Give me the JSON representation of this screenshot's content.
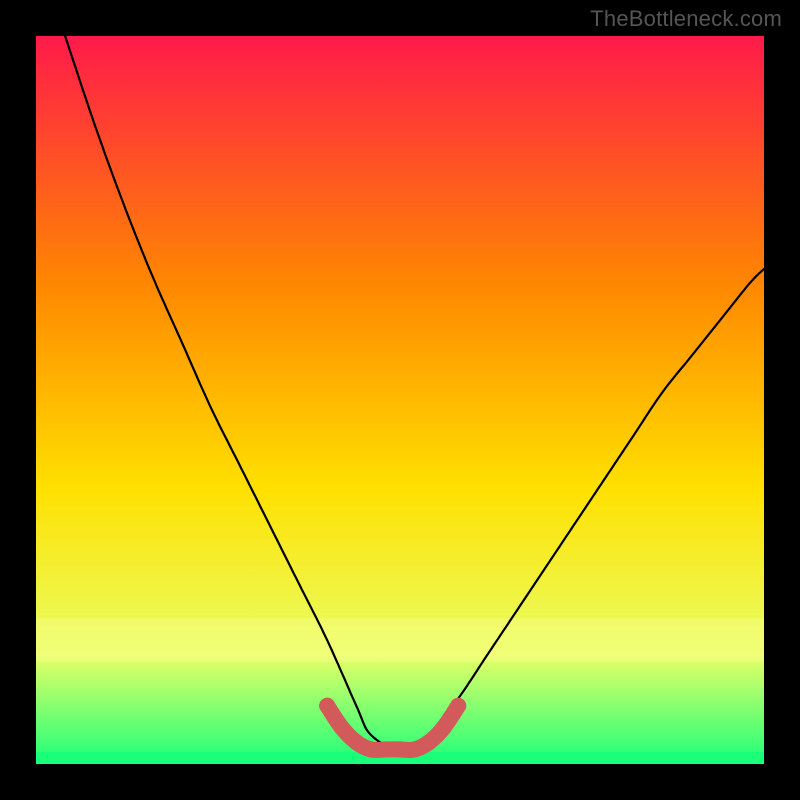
{
  "watermark": "TheBottleneck.com",
  "colors": {
    "background": "#000000",
    "gradient_top": "#ff1a4a",
    "gradient_mid1": "#ff8a00",
    "gradient_mid2": "#ffe000",
    "gradient_mid3": "#e8ff66",
    "gradient_bottom": "#1aff7a",
    "curve": "#000000",
    "marker": "#d25a5a"
  },
  "chart_data": {
    "type": "line",
    "title": "",
    "xlabel": "",
    "ylabel": "",
    "xlim": [
      0,
      100
    ],
    "ylim": [
      0,
      100
    ],
    "series": [
      {
        "name": "bottleneck-curve",
        "x": [
          4,
          8,
          12,
          16,
          20,
          24,
          28,
          32,
          36,
          40,
          44,
          46,
          50,
          54,
          58,
          62,
          66,
          70,
          74,
          78,
          82,
          86,
          90,
          94,
          98,
          100
        ],
        "values": [
          100,
          88,
          77,
          67,
          58,
          49,
          41,
          33,
          25,
          17,
          8,
          4,
          2,
          4,
          9,
          15,
          21,
          27,
          33,
          39,
          45,
          51,
          56,
          61,
          66,
          68
        ]
      },
      {
        "name": "optimal-range-markers",
        "x": [
          40,
          42,
          44,
          46,
          48,
          50,
          52,
          54,
          56,
          58
        ],
        "values": [
          8,
          5,
          3,
          2,
          2,
          2,
          2,
          3,
          5,
          8
        ]
      }
    ],
    "annotations": []
  }
}
